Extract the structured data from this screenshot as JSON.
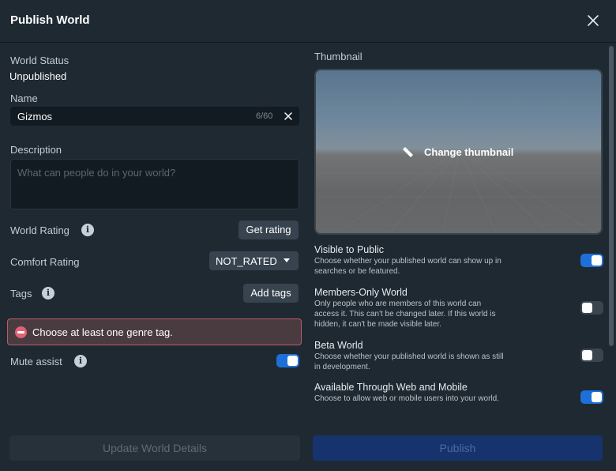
{
  "dialog": {
    "title": "Publish World"
  },
  "left": {
    "world_status_label": "World Status",
    "world_status_value": "Unpublished",
    "name_label": "Name",
    "name_value": "Gizmos",
    "name_count": "6/60",
    "description_label": "Description",
    "description_placeholder": "What can people do in your world?",
    "world_rating_label": "World Rating",
    "get_rating_label": "Get rating",
    "comfort_rating_label": "Comfort Rating",
    "comfort_rating_value": "NOT_RATED",
    "tags_label": "Tags",
    "add_tags_label": "Add tags",
    "error_text": "Choose at least one genre tag.",
    "mute_assist_label": "Mute assist",
    "mute_assist_on": true
  },
  "right": {
    "thumbnail_label": "Thumbnail",
    "change_thumbnail_label": "Change thumbnail",
    "options": [
      {
        "title": "Visible to Public",
        "desc": "Choose whether your published world can show up in searches or be featured.",
        "on": true
      },
      {
        "title": "Members-Only World",
        "desc": "Only people who are members of this world can access it. This can't be changed later. If this world is hidden, it can't be made visible later.",
        "on": false
      },
      {
        "title": "Beta World",
        "desc": "Choose whether your published world is shown as still in development.",
        "on": false
      },
      {
        "title": "Available Through Web and Mobile",
        "desc": "Choose to allow web or mobile users into your world.",
        "on": true
      }
    ]
  },
  "footer": {
    "update_label": "Update World Details",
    "publish_label": "Publish"
  },
  "colors": {
    "accent": "#1e6fd8",
    "error_border": "#c05b66",
    "error_bg": "#4a3b41"
  }
}
